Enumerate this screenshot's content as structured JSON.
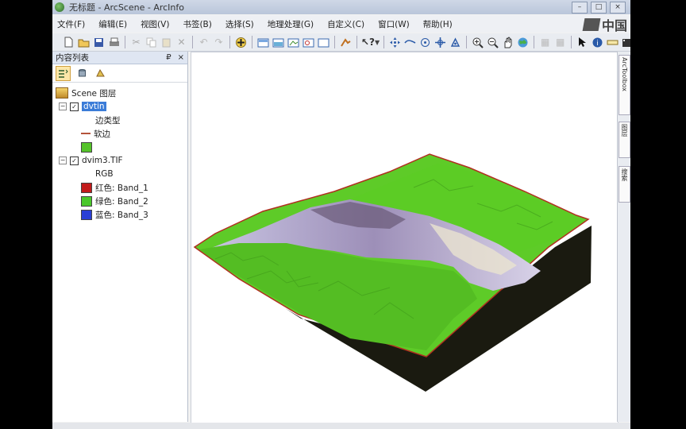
{
  "window": {
    "title": "无标题 - ArcScene - ArcInfo",
    "minimize": "–",
    "maximize": "□",
    "close": "×"
  },
  "menu": [
    "文件(F)",
    "编辑(E)",
    "视图(V)",
    "书签(B)",
    "选择(S)",
    "地理处理(G)",
    "自定义(C)",
    "窗口(W)",
    "帮助(H)"
  ],
  "watermark": {
    "text": "中国"
  },
  "toc": {
    "title": "内容列表",
    "pin": "₽",
    "close": "×",
    "scene_label": "Scene 图层",
    "layers": [
      {
        "name": "dvtin",
        "checked": true,
        "legend": [
          {
            "label": "边类型",
            "symbol": "none"
          },
          {
            "label": "软边",
            "symbol": "line",
            "color": "#b4533a"
          },
          {
            "label": "",
            "symbol": "fill",
            "color": "#55c32a"
          }
        ]
      },
      {
        "name": "dvim3.TIF",
        "checked": true,
        "legend": [
          {
            "label": "RGB",
            "symbol": "none"
          },
          {
            "label": "红色:   Band_1",
            "symbol": "fill",
            "color": "#c21b1b"
          },
          {
            "label": "绿色: Band_2",
            "symbol": "fill",
            "color": "#4ac72a"
          },
          {
            "label": "蓝色:   Band_3",
            "symbol": "fill",
            "color": "#2a3fd6"
          }
        ]
      }
    ]
  },
  "dock_tabs": [
    "ArcToolbox",
    "图层",
    "搜索"
  ],
  "scene_colors": {
    "terrain": "#5ecb28",
    "terrain_dark": "#3f9a1a",
    "edge": "#b03020",
    "shadow": "#1a1a10",
    "river": "#c7c1e0"
  }
}
